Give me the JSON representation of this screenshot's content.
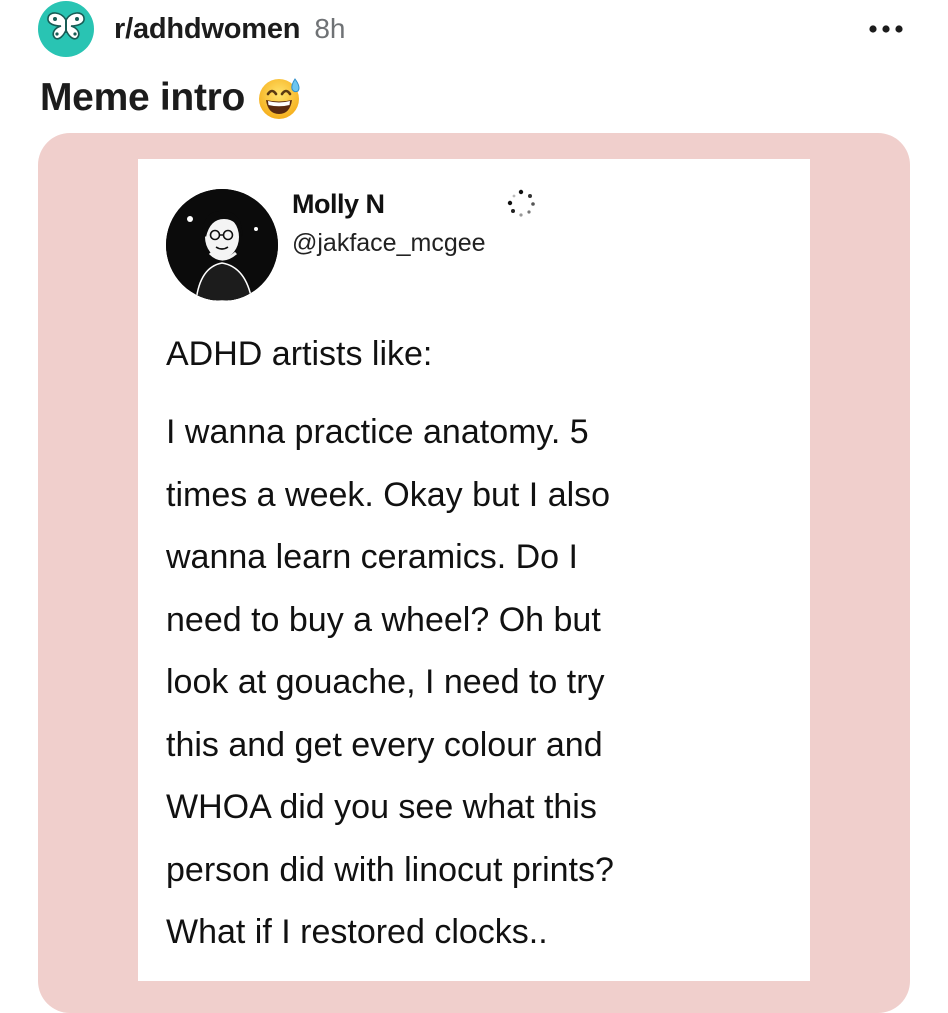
{
  "post": {
    "subreddit": "r/adhdwomen",
    "age": "8h",
    "title": "Meme intro",
    "title_emoji": "grinning-sweat-emoji-icon",
    "subreddit_icon": "butterfly-icon",
    "more_icon": "more-horizontal-icon"
  },
  "tweet": {
    "name": "Molly N",
    "handle": "@jakface_mcgee",
    "intro": "ADHD artists like:",
    "body_lines": [
      "I wanna practice anatomy. 5",
      "times a week. Okay but I also",
      "wanna learn ceramics. Do I",
      "need to buy a wheel? Oh but",
      "look at gouache, I need to try",
      "this and get every colour and",
      "WHOA did you see what this",
      "person did with linocut prints?",
      "What if I restored clocks.."
    ]
  },
  "colors": {
    "subreddit_avatar_bg": "#29c4b3",
    "card_bg": "#f0cfcc",
    "meta_text": "#6f7275"
  }
}
